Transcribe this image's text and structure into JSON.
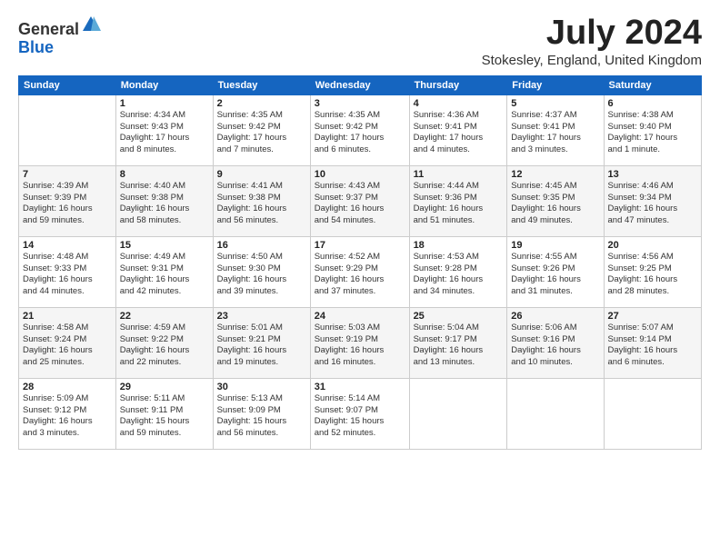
{
  "logo": {
    "general": "General",
    "blue": "Blue"
  },
  "title": "July 2024",
  "location": "Stokesley, England, United Kingdom",
  "days_header": [
    "Sunday",
    "Monday",
    "Tuesday",
    "Wednesday",
    "Thursday",
    "Friday",
    "Saturday"
  ],
  "weeks": [
    [
      {
        "num": "",
        "info": ""
      },
      {
        "num": "1",
        "info": "Sunrise: 4:34 AM\nSunset: 9:43 PM\nDaylight: 17 hours\nand 8 minutes."
      },
      {
        "num": "2",
        "info": "Sunrise: 4:35 AM\nSunset: 9:42 PM\nDaylight: 17 hours\nand 7 minutes."
      },
      {
        "num": "3",
        "info": "Sunrise: 4:35 AM\nSunset: 9:42 PM\nDaylight: 17 hours\nand 6 minutes."
      },
      {
        "num": "4",
        "info": "Sunrise: 4:36 AM\nSunset: 9:41 PM\nDaylight: 17 hours\nand 4 minutes."
      },
      {
        "num": "5",
        "info": "Sunrise: 4:37 AM\nSunset: 9:41 PM\nDaylight: 17 hours\nand 3 minutes."
      },
      {
        "num": "6",
        "info": "Sunrise: 4:38 AM\nSunset: 9:40 PM\nDaylight: 17 hours\nand 1 minute."
      }
    ],
    [
      {
        "num": "7",
        "info": "Sunrise: 4:39 AM\nSunset: 9:39 PM\nDaylight: 16 hours\nand 59 minutes."
      },
      {
        "num": "8",
        "info": "Sunrise: 4:40 AM\nSunset: 9:38 PM\nDaylight: 16 hours\nand 58 minutes."
      },
      {
        "num": "9",
        "info": "Sunrise: 4:41 AM\nSunset: 9:38 PM\nDaylight: 16 hours\nand 56 minutes."
      },
      {
        "num": "10",
        "info": "Sunrise: 4:43 AM\nSunset: 9:37 PM\nDaylight: 16 hours\nand 54 minutes."
      },
      {
        "num": "11",
        "info": "Sunrise: 4:44 AM\nSunset: 9:36 PM\nDaylight: 16 hours\nand 51 minutes."
      },
      {
        "num": "12",
        "info": "Sunrise: 4:45 AM\nSunset: 9:35 PM\nDaylight: 16 hours\nand 49 minutes."
      },
      {
        "num": "13",
        "info": "Sunrise: 4:46 AM\nSunset: 9:34 PM\nDaylight: 16 hours\nand 47 minutes."
      }
    ],
    [
      {
        "num": "14",
        "info": "Sunrise: 4:48 AM\nSunset: 9:33 PM\nDaylight: 16 hours\nand 44 minutes."
      },
      {
        "num": "15",
        "info": "Sunrise: 4:49 AM\nSunset: 9:31 PM\nDaylight: 16 hours\nand 42 minutes."
      },
      {
        "num": "16",
        "info": "Sunrise: 4:50 AM\nSunset: 9:30 PM\nDaylight: 16 hours\nand 39 minutes."
      },
      {
        "num": "17",
        "info": "Sunrise: 4:52 AM\nSunset: 9:29 PM\nDaylight: 16 hours\nand 37 minutes."
      },
      {
        "num": "18",
        "info": "Sunrise: 4:53 AM\nSunset: 9:28 PM\nDaylight: 16 hours\nand 34 minutes."
      },
      {
        "num": "19",
        "info": "Sunrise: 4:55 AM\nSunset: 9:26 PM\nDaylight: 16 hours\nand 31 minutes."
      },
      {
        "num": "20",
        "info": "Sunrise: 4:56 AM\nSunset: 9:25 PM\nDaylight: 16 hours\nand 28 minutes."
      }
    ],
    [
      {
        "num": "21",
        "info": "Sunrise: 4:58 AM\nSunset: 9:24 PM\nDaylight: 16 hours\nand 25 minutes."
      },
      {
        "num": "22",
        "info": "Sunrise: 4:59 AM\nSunset: 9:22 PM\nDaylight: 16 hours\nand 22 minutes."
      },
      {
        "num": "23",
        "info": "Sunrise: 5:01 AM\nSunset: 9:21 PM\nDaylight: 16 hours\nand 19 minutes."
      },
      {
        "num": "24",
        "info": "Sunrise: 5:03 AM\nSunset: 9:19 PM\nDaylight: 16 hours\nand 16 minutes."
      },
      {
        "num": "25",
        "info": "Sunrise: 5:04 AM\nSunset: 9:17 PM\nDaylight: 16 hours\nand 13 minutes."
      },
      {
        "num": "26",
        "info": "Sunrise: 5:06 AM\nSunset: 9:16 PM\nDaylight: 16 hours\nand 10 minutes."
      },
      {
        "num": "27",
        "info": "Sunrise: 5:07 AM\nSunset: 9:14 PM\nDaylight: 16 hours\nand 6 minutes."
      }
    ],
    [
      {
        "num": "28",
        "info": "Sunrise: 5:09 AM\nSunset: 9:12 PM\nDaylight: 16 hours\nand 3 minutes."
      },
      {
        "num": "29",
        "info": "Sunrise: 5:11 AM\nSunset: 9:11 PM\nDaylight: 15 hours\nand 59 minutes."
      },
      {
        "num": "30",
        "info": "Sunrise: 5:13 AM\nSunset: 9:09 PM\nDaylight: 15 hours\nand 56 minutes."
      },
      {
        "num": "31",
        "info": "Sunrise: 5:14 AM\nSunset: 9:07 PM\nDaylight: 15 hours\nand 52 minutes."
      },
      {
        "num": "",
        "info": ""
      },
      {
        "num": "",
        "info": ""
      },
      {
        "num": "",
        "info": ""
      }
    ]
  ]
}
